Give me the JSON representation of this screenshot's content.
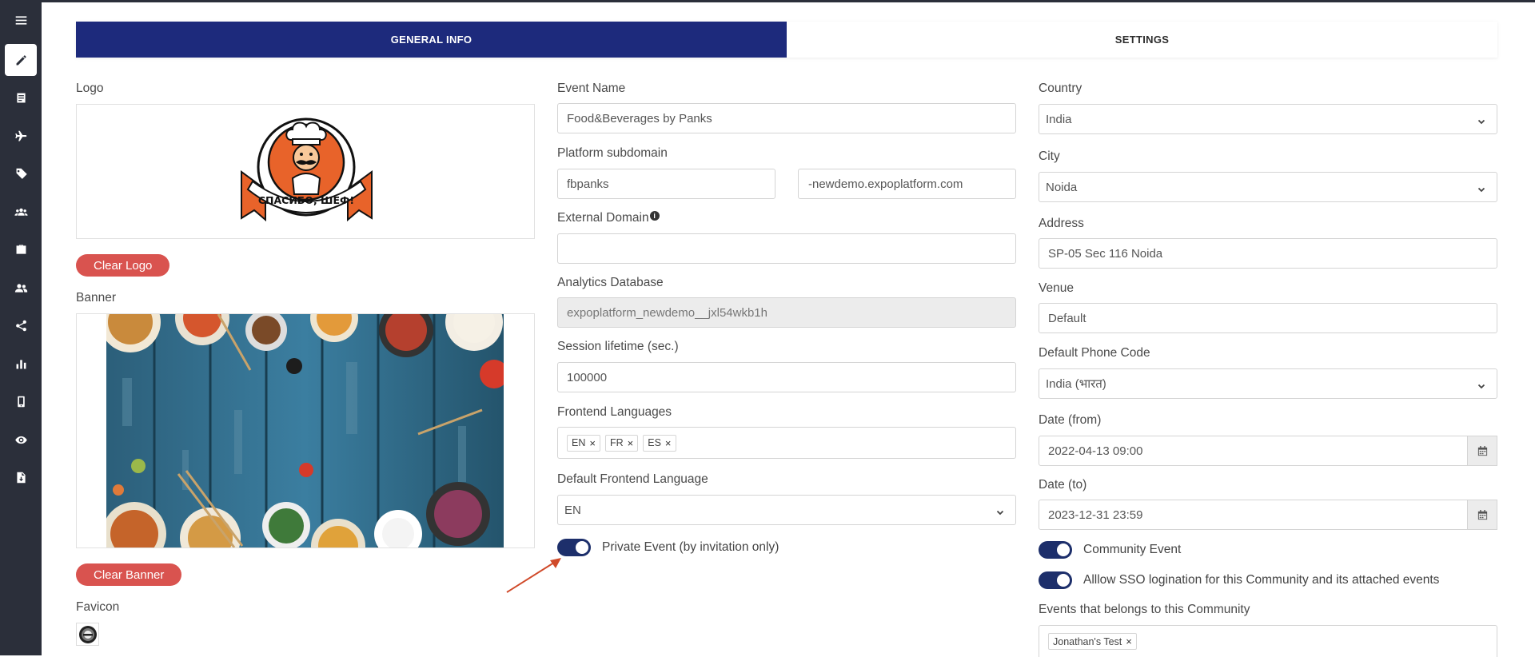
{
  "tabs": {
    "general": "GENERAL INFO",
    "settings": "SETTINGS"
  },
  "left": {
    "logo_label": "Logo",
    "logo_text": "СПАСИБО, ШЕФ!",
    "clear_logo": "Clear Logo",
    "banner_label": "Banner",
    "clear_banner": "Clear Banner",
    "favicon_label": "Favicon"
  },
  "middle": {
    "event_name_label": "Event Name",
    "event_name": "Food&Beverages by Panks",
    "subdomain_label": "Platform subdomain",
    "subdomain": "fbpanks",
    "subdomain_suffix": "-newdemo.expoplatform.com",
    "external_domain_label": "External Domain",
    "external_domain": "",
    "analytics_label": "Analytics Database",
    "analytics_db": "expoplatform_newdemo__jxl54wkb1h",
    "session_label": "Session lifetime (sec.)",
    "session_value": "100000",
    "frontend_languages_label": "Frontend Languages",
    "frontend_languages": [
      "EN",
      "FR",
      "ES"
    ],
    "default_language_label": "Default Frontend Language",
    "default_language": "EN",
    "private_event_label": "Private Event (by invitation only)",
    "private_event_on": true
  },
  "right": {
    "country_label": "Country",
    "country": "India",
    "city_label": "City",
    "city": "Noida",
    "address_label": "Address",
    "address": "SP-05 Sec 116 Noida",
    "venue_label": "Venue",
    "venue": "Default",
    "phone_code_label": "Default Phone Code",
    "phone_code": "India (भारत)",
    "date_from_label": "Date (from)",
    "date_from": "2022-04-13 09:00",
    "date_to_label": "Date (to)",
    "date_to": "2023-12-31 23:59",
    "community_event_label": "Community Event",
    "sso_label": "Alllow SSO logination for this Community and its attached events",
    "events_community_label": "Events that belongs to this Community",
    "events_community": [
      "Jonathan's Test"
    ]
  },
  "colors": {
    "accent": "#1d2a7c",
    "danger": "#d9534f",
    "sidebar": "#2b2f3a",
    "toggle": "#1d2f6b",
    "arrow": "#d04a2a"
  },
  "icons": [
    "menu-icon",
    "pencil-icon",
    "list-icon",
    "plane-icon",
    "tag-icon",
    "users-icon",
    "briefcase-icon",
    "user-group-icon",
    "share-icon",
    "bar-chart-icon",
    "mobile-icon",
    "eye-icon",
    "file-export-icon"
  ]
}
